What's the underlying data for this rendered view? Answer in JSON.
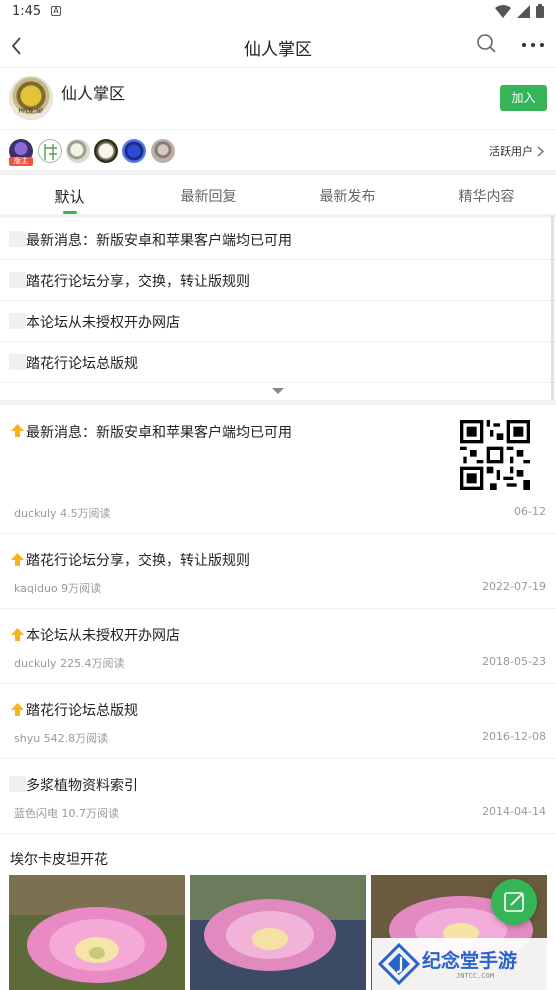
{
  "status_bar": {
    "time": "1:45",
    "notification_glyph": "A",
    "icons": [
      "wifi-icon",
      "signal-icon",
      "battery-icon"
    ]
  },
  "app_bar": {
    "title": "仙人掌区",
    "icons": [
      "back-arrow-icon",
      "search-icon",
      "more-icon"
    ]
  },
  "forum": {
    "name": "仙人掌区",
    "logo_caption": "PPCN.NF",
    "join_label": "加入",
    "owner_badge": "版主",
    "active_users_label": "活跃用户",
    "active_user_count_shown": 6
  },
  "tabs": [
    {
      "label": "默认",
      "active": true
    },
    {
      "label": "最新回复",
      "active": false
    },
    {
      "label": "最新发布",
      "active": false
    },
    {
      "label": "精华内容",
      "active": false
    }
  ],
  "pinned": [
    "最新消息：新版安卓和苹果客户端均已可用",
    "踏花行论坛分享，交换，转让版规则",
    "本论坛从未授权开办网店",
    "踏花行论坛总版规"
  ],
  "posts": [
    {
      "title": "最新消息：新版安卓和苹果客户端均已可用",
      "author": "duckuly 4.5万阅读",
      "date": "06-12",
      "pinned": true,
      "has_qr": true
    },
    {
      "title": "踏花行论坛分享，交换，转让版规则",
      "author": "kaqiduo 9万阅读",
      "date": "2022-07-19",
      "pinned": true
    },
    {
      "title": "本论坛从未授权开办网店",
      "author": "duckuly 225.4万阅读",
      "date": "2018-05-23",
      "pinned": true
    },
    {
      "title": "踏花行论坛总版规",
      "author": "shyu 542.8万阅读",
      "date": "2016-12-08",
      "pinned": true
    },
    {
      "title": "多浆植物资料索引",
      "author": "蓝色闪电 10.7万阅读",
      "date": "2014-04-14",
      "pinned": false
    }
  ],
  "image_post": {
    "title": "埃尔卡皮坦开花"
  },
  "watermark": {
    "text": "纪念堂手游",
    "subtext": "JNTCC.COM"
  },
  "colors": {
    "accent": "#35b558",
    "owner_badge": "#f2543c",
    "pin_icon": "#f5b417",
    "watermark": "#2a63c9"
  }
}
